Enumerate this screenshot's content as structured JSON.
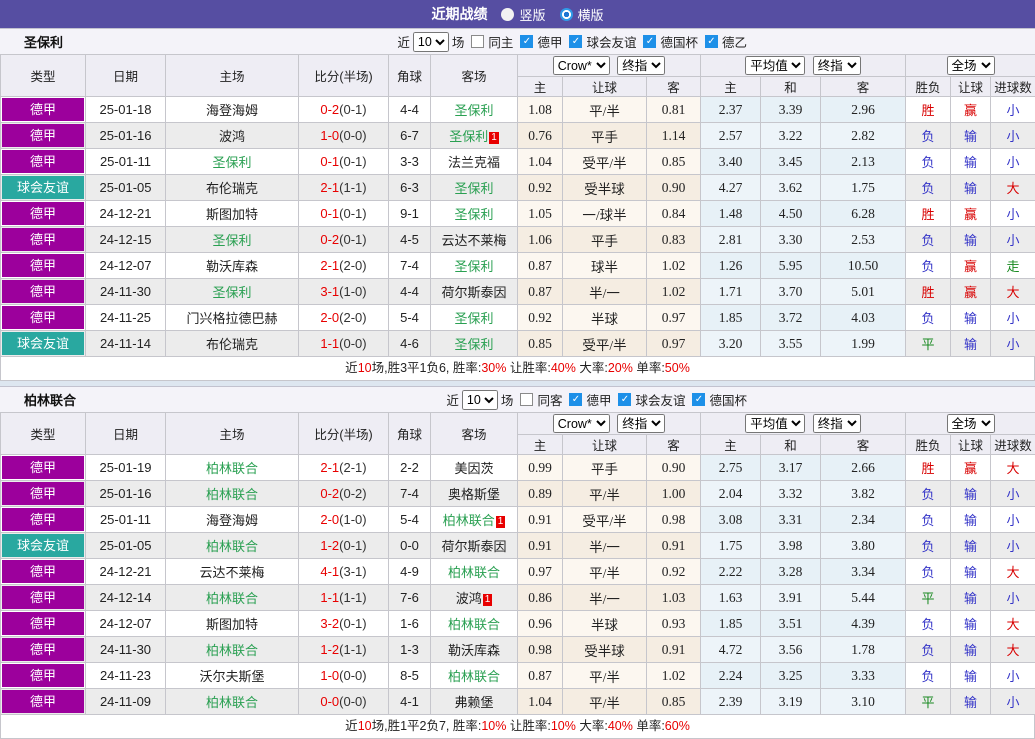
{
  "titlebar": {
    "title": "近期战绩",
    "layout_options": [
      {
        "label": "竖版",
        "selected": false
      },
      {
        "label": "横版",
        "selected": true
      }
    ]
  },
  "colors": {
    "league_top": "#9c009c",
    "league_friendly": "#29a8a0",
    "focus_team": "#2aa052",
    "score": "#e80000",
    "result": {
      "r": "#d80000",
      "b": "#3434c8",
      "g": "#17891f"
    }
  },
  "headers": {
    "left": [
      "类型",
      "日期",
      "主场",
      "比分(半场)",
      "角球",
      "客场"
    ],
    "sub": [
      "主",
      "让球",
      "客",
      "主",
      "和",
      "客",
      "胜负",
      "让球",
      "进球数"
    ],
    "select_odds_source": "Crow*",
    "select_odds_time": "终指",
    "select_avg": "平均值",
    "select_avg_time": "终指",
    "select_scope": "全场"
  },
  "sections": [
    {
      "team": "圣保利",
      "filter": {
        "prefix": "近",
        "matches": "10",
        "suffix": "场",
        "same_label": "同主",
        "same_checked": false,
        "leagues": [
          {
            "label": "德甲",
            "checked": true
          },
          {
            "label": "球会友谊",
            "checked": true
          },
          {
            "label": "德国杯",
            "checked": true
          },
          {
            "label": "德乙",
            "checked": true
          }
        ]
      },
      "rows": [
        {
          "lg": "德甲",
          "lgc": "#9c009c",
          "date": "25-01-18",
          "home": "海登海姆",
          "hf": false,
          "hc": "",
          "score": "0-2",
          "half": "(0-1)",
          "cor": "4-4",
          "away": "圣保利",
          "af": true,
          "ac": "",
          "o": [
            "1.08",
            "平/半",
            "0.81"
          ],
          "a": [
            "2.37",
            "3.39",
            "2.96"
          ],
          "r": [
            [
              "胜",
              "r"
            ],
            [
              "赢",
              "r"
            ],
            [
              "小",
              "b"
            ]
          ]
        },
        {
          "lg": "德甲",
          "lgc": "#9c009c",
          "date": "25-01-16",
          "home": "波鸿",
          "hf": false,
          "hc": "",
          "score": "1-0",
          "half": "(0-0)",
          "cor": "6-7",
          "away": "圣保利",
          "af": true,
          "ac": "1",
          "o": [
            "0.76",
            "平手",
            "1.14"
          ],
          "a": [
            "2.57",
            "3.22",
            "2.82"
          ],
          "r": [
            [
              "负",
              "b"
            ],
            [
              "输",
              "b"
            ],
            [
              "小",
              "b"
            ]
          ]
        },
        {
          "lg": "德甲",
          "lgc": "#9c009c",
          "date": "25-01-11",
          "home": "圣保利",
          "hf": true,
          "hc": "",
          "score": "0-1",
          "half": "(0-1)",
          "cor": "3-3",
          "away": "法兰克福",
          "af": false,
          "ac": "",
          "o": [
            "1.04",
            "受平/半",
            "0.85"
          ],
          "a": [
            "3.40",
            "3.45",
            "2.13"
          ],
          "r": [
            [
              "负",
              "b"
            ],
            [
              "输",
              "b"
            ],
            [
              "小",
              "b"
            ]
          ]
        },
        {
          "lg": "球会友谊",
          "lgc": "#29a8a0",
          "date": "25-01-05",
          "home": "布伦瑞克",
          "hf": false,
          "hc": "",
          "score": "2-1",
          "half": "(1-1)",
          "cor": "6-3",
          "away": "圣保利",
          "af": true,
          "ac": "",
          "o": [
            "0.92",
            "受半球",
            "0.90"
          ],
          "a": [
            "4.27",
            "3.62",
            "1.75"
          ],
          "r": [
            [
              "负",
              "b"
            ],
            [
              "输",
              "b"
            ],
            [
              "大",
              "r"
            ]
          ]
        },
        {
          "lg": "德甲",
          "lgc": "#9c009c",
          "date": "24-12-21",
          "home": "斯图加特",
          "hf": false,
          "hc": "",
          "score": "0-1",
          "half": "(0-1)",
          "cor": "9-1",
          "away": "圣保利",
          "af": true,
          "ac": "",
          "o": [
            "1.05",
            "一/球半",
            "0.84"
          ],
          "a": [
            "1.48",
            "4.50",
            "6.28"
          ],
          "r": [
            [
              "胜",
              "r"
            ],
            [
              "赢",
              "r"
            ],
            [
              "小",
              "b"
            ]
          ]
        },
        {
          "lg": "德甲",
          "lgc": "#9c009c",
          "date": "24-12-15",
          "home": "圣保利",
          "hf": true,
          "hc": "",
          "score": "0-2",
          "half": "(0-1)",
          "cor": "4-5",
          "away": "云达不莱梅",
          "af": false,
          "ac": "",
          "o": [
            "1.06",
            "平手",
            "0.83"
          ],
          "a": [
            "2.81",
            "3.30",
            "2.53"
          ],
          "r": [
            [
              "负",
              "b"
            ],
            [
              "输",
              "b"
            ],
            [
              "小",
              "b"
            ]
          ]
        },
        {
          "lg": "德甲",
          "lgc": "#9c009c",
          "date": "24-12-07",
          "home": "勒沃库森",
          "hf": false,
          "hc": "",
          "score": "2-1",
          "half": "(2-0)",
          "cor": "7-4",
          "away": "圣保利",
          "af": true,
          "ac": "",
          "o": [
            "0.87",
            "球半",
            "1.02"
          ],
          "a": [
            "1.26",
            "5.95",
            "10.50"
          ],
          "r": [
            [
              "负",
              "b"
            ],
            [
              "赢",
              "r"
            ],
            [
              "走",
              "g"
            ]
          ]
        },
        {
          "lg": "德甲",
          "lgc": "#9c009c",
          "date": "24-11-30",
          "home": "圣保利",
          "hf": true,
          "hc": "",
          "score": "3-1",
          "half": "(1-0)",
          "cor": "4-4",
          "away": "荷尔斯泰因",
          "af": false,
          "ac": "",
          "o": [
            "0.87",
            "半/一",
            "1.02"
          ],
          "a": [
            "1.71",
            "3.70",
            "5.01"
          ],
          "r": [
            [
              "胜",
              "r"
            ],
            [
              "赢",
              "r"
            ],
            [
              "大",
              "r"
            ]
          ]
        },
        {
          "lg": "德甲",
          "lgc": "#9c009c",
          "date": "24-11-25",
          "home": "门兴格拉德巴赫",
          "hf": false,
          "hc": "",
          "score": "2-0",
          "half": "(2-0)",
          "cor": "5-4",
          "away": "圣保利",
          "af": true,
          "ac": "",
          "o": [
            "0.92",
            "半球",
            "0.97"
          ],
          "a": [
            "1.85",
            "3.72",
            "4.03"
          ],
          "r": [
            [
              "负",
              "b"
            ],
            [
              "输",
              "b"
            ],
            [
              "小",
              "b"
            ]
          ]
        },
        {
          "lg": "球会友谊",
          "lgc": "#29a8a0",
          "date": "24-11-14",
          "home": "布伦瑞克",
          "hf": false,
          "hc": "",
          "score": "1-1",
          "half": "(0-0)",
          "cor": "4-6",
          "away": "圣保利",
          "af": true,
          "ac": "",
          "o": [
            "0.85",
            "受平/半",
            "0.97"
          ],
          "a": [
            "3.20",
            "3.55",
            "1.99"
          ],
          "r": [
            [
              "平",
              "g"
            ],
            [
              "输",
              "b"
            ],
            [
              "小",
              "b"
            ]
          ]
        }
      ],
      "summary": [
        [
          "近",
          "k"
        ],
        [
          "10",
          "r"
        ],
        [
          "场,胜3平1负6, 胜率:",
          "k"
        ],
        [
          "30%",
          "r"
        ],
        [
          " 让胜率:",
          "k"
        ],
        [
          "40%",
          "r"
        ],
        [
          " 大率:",
          "k"
        ],
        [
          "20%",
          "r"
        ],
        [
          " 单率:",
          "k"
        ],
        [
          "50%",
          "r"
        ]
      ]
    },
    {
      "team": "柏林联合",
      "filter": {
        "prefix": "近",
        "matches": "10",
        "suffix": "场",
        "same_label": "同客",
        "same_checked": false,
        "leagues": [
          {
            "label": "德甲",
            "checked": true
          },
          {
            "label": "球会友谊",
            "checked": true
          },
          {
            "label": "德国杯",
            "checked": true
          }
        ]
      },
      "rows": [
        {
          "lg": "德甲",
          "lgc": "#9c009c",
          "date": "25-01-19",
          "home": "柏林联合",
          "hf": true,
          "hc": "",
          "score": "2-1",
          "half": "(2-1)",
          "cor": "2-2",
          "away": "美因茨",
          "af": false,
          "ac": "",
          "o": [
            "0.99",
            "平手",
            "0.90"
          ],
          "a": [
            "2.75",
            "3.17",
            "2.66"
          ],
          "r": [
            [
              "胜",
              "r"
            ],
            [
              "赢",
              "r"
            ],
            [
              "大",
              "r"
            ]
          ]
        },
        {
          "lg": "德甲",
          "lgc": "#9c009c",
          "date": "25-01-16",
          "home": "柏林联合",
          "hf": true,
          "hc": "",
          "score": "0-2",
          "half": "(0-2)",
          "cor": "7-4",
          "away": "奥格斯堡",
          "af": false,
          "ac": "",
          "o": [
            "0.89",
            "平/半",
            "1.00"
          ],
          "a": [
            "2.04",
            "3.32",
            "3.82"
          ],
          "r": [
            [
              "负",
              "b"
            ],
            [
              "输",
              "b"
            ],
            [
              "小",
              "b"
            ]
          ]
        },
        {
          "lg": "德甲",
          "lgc": "#9c009c",
          "date": "25-01-11",
          "home": "海登海姆",
          "hf": false,
          "hc": "",
          "score": "2-0",
          "half": "(1-0)",
          "cor": "5-4",
          "away": "柏林联合",
          "af": true,
          "ac": "1",
          "o": [
            "0.91",
            "受平/半",
            "0.98"
          ],
          "a": [
            "3.08",
            "3.31",
            "2.34"
          ],
          "r": [
            [
              "负",
              "b"
            ],
            [
              "输",
              "b"
            ],
            [
              "小",
              "b"
            ]
          ]
        },
        {
          "lg": "球会友谊",
          "lgc": "#29a8a0",
          "date": "25-01-05",
          "home": "柏林联合",
          "hf": true,
          "hc": "",
          "score": "1-2",
          "half": "(0-1)",
          "cor": "0-0",
          "away": "荷尔斯泰因",
          "af": false,
          "ac": "",
          "o": [
            "0.91",
            "半/一",
            "0.91"
          ],
          "a": [
            "1.75",
            "3.98",
            "3.80"
          ],
          "r": [
            [
              "负",
              "b"
            ],
            [
              "输",
              "b"
            ],
            [
              "小",
              "b"
            ]
          ]
        },
        {
          "lg": "德甲",
          "lgc": "#9c009c",
          "date": "24-12-21",
          "home": "云达不莱梅",
          "hf": false,
          "hc": "",
          "score": "4-1",
          "half": "(3-1)",
          "cor": "4-9",
          "away": "柏林联合",
          "af": true,
          "ac": "",
          "o": [
            "0.97",
            "平/半",
            "0.92"
          ],
          "a": [
            "2.22",
            "3.28",
            "3.34"
          ],
          "r": [
            [
              "负",
              "b"
            ],
            [
              "输",
              "b"
            ],
            [
              "大",
              "r"
            ]
          ]
        },
        {
          "lg": "德甲",
          "lgc": "#9c009c",
          "date": "24-12-14",
          "home": "柏林联合",
          "hf": true,
          "hc": "",
          "score": "1-1",
          "half": "(1-1)",
          "cor": "7-6",
          "away": "波鸿",
          "af": false,
          "ac": "1",
          "o": [
            "0.86",
            "半/一",
            "1.03"
          ],
          "a": [
            "1.63",
            "3.91",
            "5.44"
          ],
          "r": [
            [
              "平",
              "g"
            ],
            [
              "输",
              "b"
            ],
            [
              "小",
              "b"
            ]
          ]
        },
        {
          "lg": "德甲",
          "lgc": "#9c009c",
          "date": "24-12-07",
          "home": "斯图加特",
          "hf": false,
          "hc": "",
          "score": "3-2",
          "half": "(0-1)",
          "cor": "1-6",
          "away": "柏林联合",
          "af": true,
          "ac": "",
          "o": [
            "0.96",
            "半球",
            "0.93"
          ],
          "a": [
            "1.85",
            "3.51",
            "4.39"
          ],
          "r": [
            [
              "负",
              "b"
            ],
            [
              "输",
              "b"
            ],
            [
              "大",
              "r"
            ]
          ]
        },
        {
          "lg": "德甲",
          "lgc": "#9c009c",
          "date": "24-11-30",
          "home": "柏林联合",
          "hf": true,
          "hc": "",
          "score": "1-2",
          "half": "(1-1)",
          "cor": "1-3",
          "away": "勒沃库森",
          "af": false,
          "ac": "",
          "o": [
            "0.98",
            "受半球",
            "0.91"
          ],
          "a": [
            "4.72",
            "3.56",
            "1.78"
          ],
          "r": [
            [
              "负",
              "b"
            ],
            [
              "输",
              "b"
            ],
            [
              "大",
              "r"
            ]
          ]
        },
        {
          "lg": "德甲",
          "lgc": "#9c009c",
          "date": "24-11-23",
          "home": "沃尔夫斯堡",
          "hf": false,
          "hc": "",
          "score": "1-0",
          "half": "(0-0)",
          "cor": "8-5",
          "away": "柏林联合",
          "af": true,
          "ac": "",
          "o": [
            "0.87",
            "平/半",
            "1.02"
          ],
          "a": [
            "2.24",
            "3.25",
            "3.33"
          ],
          "r": [
            [
              "负",
              "b"
            ],
            [
              "输",
              "b"
            ],
            [
              "小",
              "b"
            ]
          ]
        },
        {
          "lg": "德甲",
          "lgc": "#9c009c",
          "date": "24-11-09",
          "home": "柏林联合",
          "hf": true,
          "hc": "",
          "score": "0-0",
          "half": "(0-0)",
          "cor": "4-1",
          "away": "弗赖堡",
          "af": false,
          "ac": "",
          "o": [
            "1.04",
            "平/半",
            "0.85"
          ],
          "a": [
            "2.39",
            "3.19",
            "3.10"
          ],
          "r": [
            [
              "平",
              "g"
            ],
            [
              "输",
              "b"
            ],
            [
              "小",
              "b"
            ]
          ]
        }
      ],
      "summary": [
        [
          "近",
          "k"
        ],
        [
          "10",
          "r"
        ],
        [
          "场,胜1平2负7, 胜率:",
          "k"
        ],
        [
          "10%",
          "r"
        ],
        [
          " 让胜率:",
          "k"
        ],
        [
          "10%",
          "r"
        ],
        [
          " 大率:",
          "k"
        ],
        [
          "40%",
          "r"
        ],
        [
          " 单率:",
          "k"
        ],
        [
          "60%",
          "r"
        ]
      ]
    }
  ]
}
